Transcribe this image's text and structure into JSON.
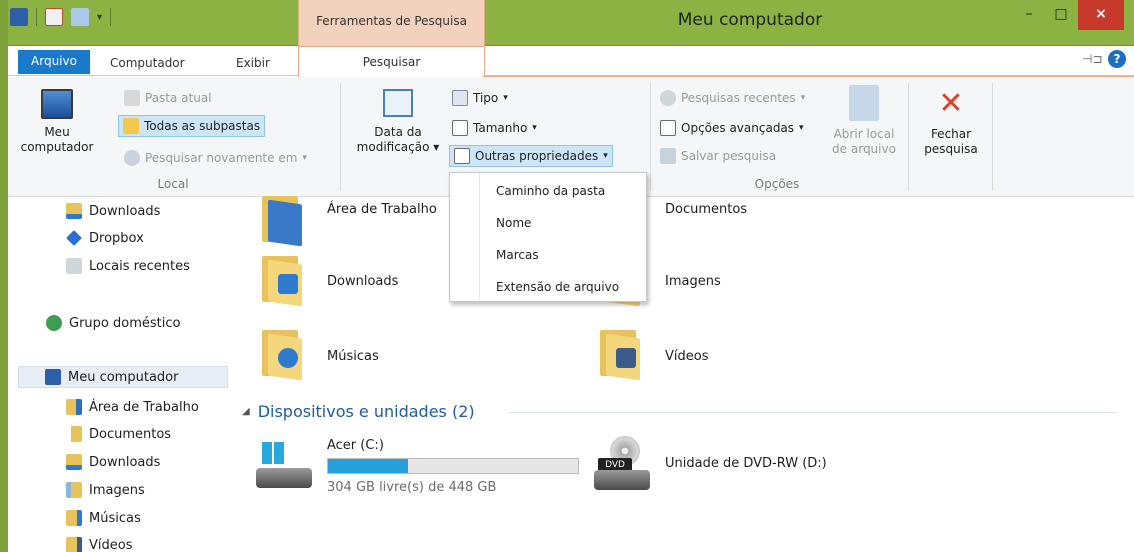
{
  "window": {
    "title": "Meu computador",
    "context_tab_group": "Ferramentas de Pesquisa",
    "controls": {
      "minimize": "–",
      "maximize": "□",
      "close": "×"
    }
  },
  "tabs": {
    "arquivo": "Arquivo",
    "computador": "Computador",
    "exibir": "Exibir",
    "pesquisar": "Pesquisar",
    "help": "?"
  },
  "ribbon": {
    "local": {
      "label": "Local",
      "meu_computador": [
        "Meu",
        "computador"
      ],
      "pasta_atual": "Pasta atual",
      "todas_subpastas": "Todas as subpastas",
      "pesquisar_novamente": "Pesquisar novamente em"
    },
    "refinar": {
      "data_modificacao": [
        "Data da",
        "modificação"
      ],
      "tipo": "Tipo",
      "tamanho": "Tamanho",
      "outras_propriedades": "Outras propriedades"
    },
    "opcoes": {
      "label": "Opções",
      "pesquisas_recentes": "Pesquisas recentes",
      "opcoes_avancadas": "Opções avançadas",
      "salvar_pesquisa": "Salvar pesquisa",
      "abrir_local": [
        "Abrir local",
        "de arquivo"
      ],
      "fechar_pesquisa": [
        "Fechar",
        "pesquisa"
      ]
    }
  },
  "dropdown": {
    "items": [
      "Caminho da pasta",
      "Nome",
      "Marcas",
      "Extensão de arquivo"
    ]
  },
  "nav": {
    "items": [
      {
        "label": "Downloads",
        "icon": "downloads-folder-icon"
      },
      {
        "label": "Dropbox",
        "icon": "dropbox-icon"
      },
      {
        "label": "Locais recentes",
        "icon": "recent-places-icon"
      },
      {
        "label": "Grupo doméstico",
        "icon": "homegroup-icon"
      },
      {
        "label": "Meu computador",
        "icon": "computer-icon"
      },
      {
        "label": "Área de Trabalho",
        "icon": "desktop-folder-icon"
      },
      {
        "label": "Documentos",
        "icon": "documents-folder-icon"
      },
      {
        "label": "Downloads",
        "icon": "downloads-folder-icon"
      },
      {
        "label": "Imagens",
        "icon": "pictures-folder-icon"
      },
      {
        "label": "Músicas",
        "icon": "music-folder-icon"
      },
      {
        "label": "Vídeos",
        "icon": "videos-folder-icon"
      }
    ]
  },
  "content": {
    "folders": [
      {
        "name": "Área de Trabalho",
        "icon": "desktop-folder-icon"
      },
      {
        "name": "Documentos",
        "icon": "documents-folder-icon"
      },
      {
        "name": "Downloads",
        "icon": "downloads-folder-icon"
      },
      {
        "name": "Imagens",
        "icon": "pictures-folder-icon"
      },
      {
        "name": "Músicas",
        "icon": "music-folder-icon"
      },
      {
        "name": "Vídeos",
        "icon": "videos-folder-icon"
      }
    ],
    "devices_header": "Dispositivos e unidades (2)",
    "drives": [
      {
        "name": "Acer (C:)",
        "free_text": "304 GB livre(s) de 448 GB",
        "used_fraction": 0.32,
        "icon": "windows-drive-icon"
      },
      {
        "name": "Unidade de DVD-RW (D:)",
        "icon": "dvd-drive-icon"
      }
    ]
  },
  "colors": {
    "title_bar": "#8cb243",
    "context_tab": "#f3d2bd",
    "accent_blue": "#1979ca",
    "close_red": "#c7392b",
    "drive_fill": "#26a0da"
  }
}
